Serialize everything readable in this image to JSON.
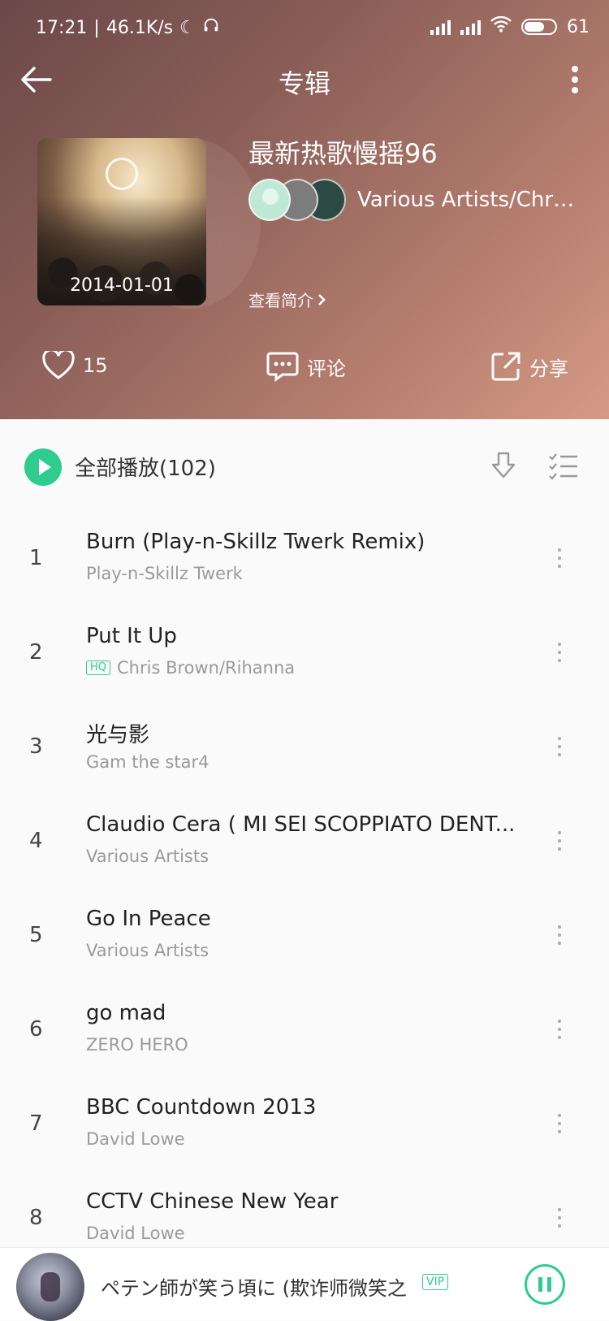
{
  "status_bar": {
    "time": "17:21",
    "speed": "46.1K/s",
    "battery": "61"
  },
  "header": {
    "title": "专辑"
  },
  "album": {
    "cover_date": "2014-01-01",
    "name": "最新热歌慢摇96",
    "artists": "Various Artists/Chri...",
    "intro_label": "查看简介"
  },
  "actions": {
    "like_count": "15",
    "comment_label": "评论",
    "share_label": "分享"
  },
  "play_all": {
    "label": "全部播放(102)"
  },
  "songs": [
    {
      "num": "1",
      "title": "Burn (Play-n-Skillz Twerk Remix)",
      "artist": "Play-n-Skillz Twerk",
      "hq": false
    },
    {
      "num": "2",
      "title": "Put It Up",
      "artist": "Chris Brown/Rihanna",
      "hq": true
    },
    {
      "num": "3",
      "title": "光与影",
      "artist": "Gam the star4",
      "hq": false
    },
    {
      "num": "4",
      "title": "Claudio Cera ( MI SEI SCOPPIATO DENT...",
      "artist": "Various Artists",
      "hq": false
    },
    {
      "num": "5",
      "title": "Go In Peace",
      "artist": "Various Artists",
      "hq": false
    },
    {
      "num": "6",
      "title": "go mad",
      "artist": "ZERO HERO",
      "hq": false
    },
    {
      "num": "7",
      "title": "BBC Countdown 2013",
      "artist": "David Lowe",
      "hq": false
    },
    {
      "num": "8",
      "title": "CCTV Chinese New Year",
      "artist": "David Lowe",
      "hq": false
    }
  ],
  "hq_badge": "HQ",
  "mini_player": {
    "track": "ペテン師が笑う頃に (欺诈师微笑之",
    "vip_badge": "VIP"
  },
  "colors": {
    "accent": "#2ecc8f",
    "hero_start": "#6b4848",
    "hero_end": "#d69a86"
  }
}
